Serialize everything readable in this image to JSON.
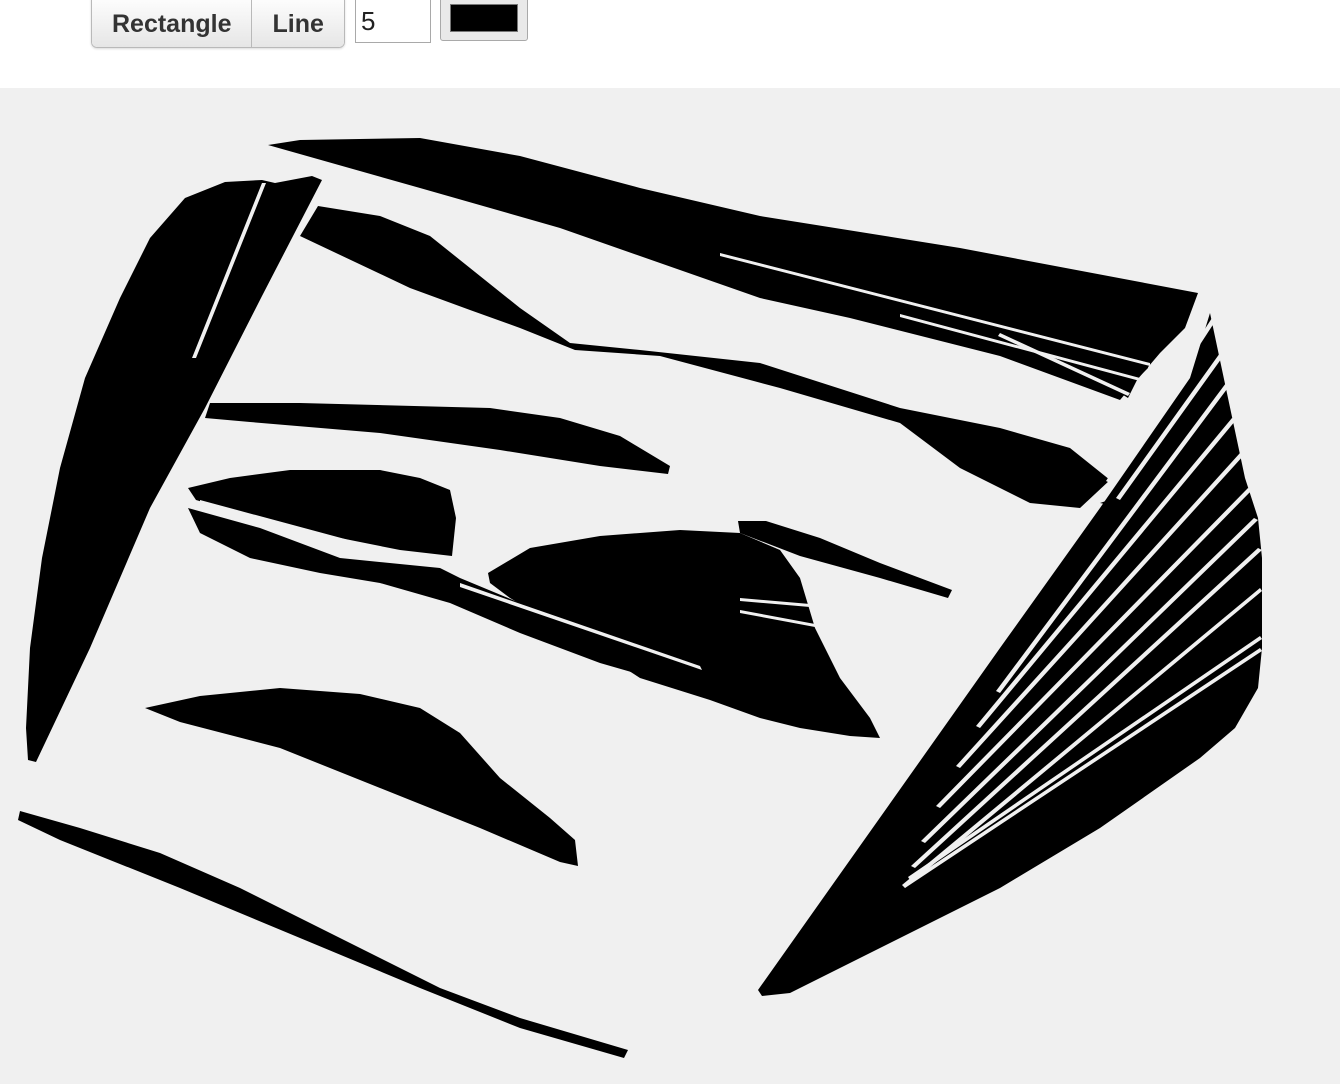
{
  "toolbar": {
    "rectangle_label": "Rectangle",
    "line_label": "Line",
    "line_width_value": "5",
    "stroke_color": "#000000"
  },
  "canvas": {
    "background_color": "#f0f0f0",
    "shape_color": "#000000"
  }
}
